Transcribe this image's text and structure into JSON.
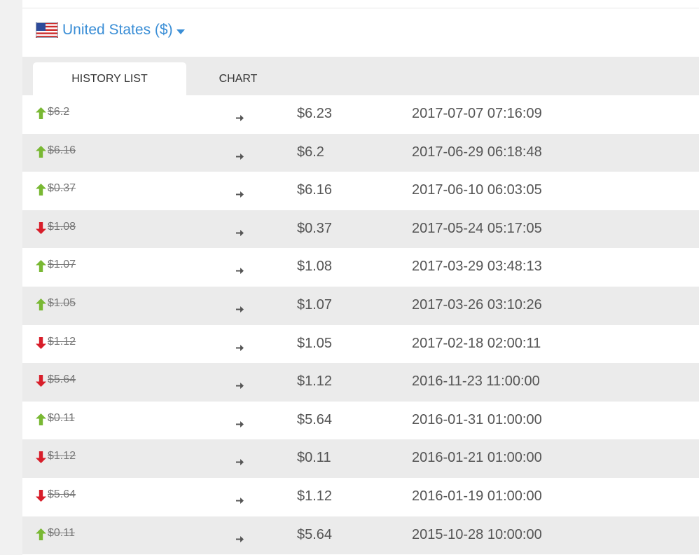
{
  "currency": {
    "label": "United States ($)",
    "flag_icon": "us-flag-icon"
  },
  "tabs": [
    {
      "label": "HISTORY LIST",
      "active": true
    },
    {
      "label": "CHART",
      "active": false
    }
  ],
  "colors": {
    "up": "#79b833",
    "down": "#d81e2a",
    "link": "#3a8ed6",
    "row_alt": "#ebebeb"
  },
  "history": [
    {
      "direction": "up",
      "old": "$6.2",
      "new": "$6.23",
      "date": "2017-07-07 07:16:09"
    },
    {
      "direction": "up",
      "old": "$6.16",
      "new": "$6.2",
      "date": "2017-06-29 06:18:48"
    },
    {
      "direction": "up",
      "old": "$0.37",
      "new": "$6.16",
      "date": "2017-06-10 06:03:05"
    },
    {
      "direction": "down",
      "old": "$1.08",
      "new": "$0.37",
      "date": "2017-05-24 05:17:05"
    },
    {
      "direction": "up",
      "old": "$1.07",
      "new": "$1.08",
      "date": "2017-03-29 03:48:13"
    },
    {
      "direction": "up",
      "old": "$1.05",
      "new": "$1.07",
      "date": "2017-03-26 03:10:26"
    },
    {
      "direction": "down",
      "old": "$1.12",
      "new": "$1.05",
      "date": "2017-02-18 02:00:11"
    },
    {
      "direction": "down",
      "old": "$5.64",
      "new": "$1.12",
      "date": "2016-11-23 11:00:00"
    },
    {
      "direction": "up",
      "old": "$0.11",
      "new": "$5.64",
      "date": "2016-01-31 01:00:00"
    },
    {
      "direction": "down",
      "old": "$1.12",
      "new": "$0.11",
      "date": "2016-01-21 01:00:00"
    },
    {
      "direction": "down",
      "old": "$5.64",
      "new": "$1.12",
      "date": "2016-01-19 01:00:00"
    },
    {
      "direction": "up",
      "old": "$0.11",
      "new": "$5.64",
      "date": "2015-10-28 10:00:00"
    }
  ]
}
